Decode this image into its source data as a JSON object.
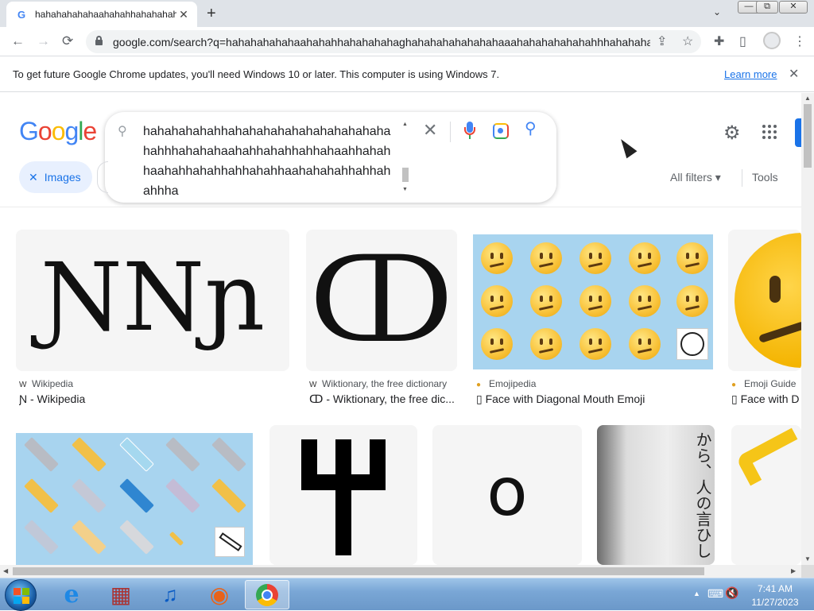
{
  "browser": {
    "tab": {
      "favicon": "G",
      "title": "hahahahahahaahahahhahahahahag"
    },
    "new_tab_label": "+",
    "address": {
      "url": "google.com/search?q=hahahahahahaahahahhahahahahaghahahahahahahahaaahahahahahahahhhahahahaaa..."
    },
    "icons": {
      "back": "←",
      "forward": "→",
      "reload": "⟳",
      "share": "⇪",
      "star": "☆",
      "extensions": "✚",
      "sidepanel": "▯",
      "menu": "⋮",
      "tab_search": "⌄",
      "minimize": "—",
      "restore": "⧉",
      "close": "✕"
    }
  },
  "infobar": {
    "message": "To get future Google Chrome updates, you'll need Windows 10 or later. This computer is using Windows 7.",
    "link": "Learn more",
    "close": "✕"
  },
  "search": {
    "logo": [
      "G",
      "o",
      "o",
      "g",
      "l",
      "e"
    ],
    "logo_colors": [
      "#4285f4",
      "#ea4335",
      "#fbbc05",
      "#4285f4",
      "#34a853",
      "#ea4335"
    ],
    "query": "hahahahahahhahahahahahahahahahahahahahhhahahahaahahhahahhahhahaahhahahhaahahhahahhahhahahhaahahahahhahhahahhha",
    "clear": "✕",
    "search_icon": "⚲",
    "chip_label": "Images",
    "chip_x": "✕",
    "all_filters": "All filters ▾",
    "tools": "Tools",
    "settings_icon": "⚙"
  },
  "results_row1": [
    {
      "source": "Wikipedia",
      "source_icon": "W",
      "title": "Ɲ - Wikipedia",
      "glyphs": "ƝNɲ"
    },
    {
      "source": "Wiktionary, the free dictionary",
      "source_icon": "W",
      "title": "ↀ - Wiktionary, the free dic...",
      "glyphs": "ↀ"
    },
    {
      "source": "Emojipedia",
      "source_icon": "●",
      "title": "▯ Face with Diagonal Mouth Emoji"
    },
    {
      "source": "Emoji Guide",
      "source_icon": "●",
      "title": "▯ Face with D"
    }
  ],
  "results_row2": [
    {
      "glyph": "Ψ"
    },
    {
      "glyph": "o"
    },
    {
      "glyph": "から、人の言ひし"
    }
  ],
  "taskbar": {
    "time": "7:41 AM",
    "date": "11/27/2023",
    "tray_icons": [
      "▲",
      "⌨",
      "🔇"
    ],
    "apps": [
      "ie",
      "store",
      "music",
      "firefox",
      "chrome"
    ],
    "app_glyphs": [
      "e",
      "▦",
      "♫",
      "◉"
    ]
  }
}
